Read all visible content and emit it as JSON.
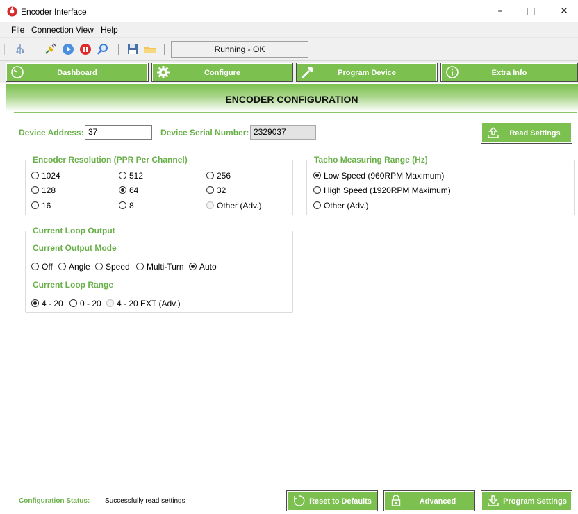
{
  "window": {
    "title": "Encoder Interface",
    "minimize": "–",
    "maximize": "□",
    "close": "✕"
  },
  "menu": [
    "File",
    "Connection",
    "View",
    "Help"
  ],
  "toolbar": {
    "status": "Running - OK",
    "icons": [
      "usb-icon",
      "plug-icon",
      "play-icon",
      "stop-icon",
      "search-icon",
      "save-icon",
      "folder-icon"
    ]
  },
  "nav": {
    "dashboard": "Dashboard",
    "configure": "Configure",
    "program_device": "Program Device",
    "extra_info": "Extra Info"
  },
  "page": {
    "title": "ENCODER CONFIGURATION"
  },
  "device": {
    "address_label": "Device Address:",
    "address_value": "37",
    "serial_label": "Device Serial Number:",
    "serial_value": "2329037",
    "read_settings": "Read Settings"
  },
  "resolution": {
    "title": "Encoder Resolution (PPR Per Channel)",
    "options": [
      {
        "label": "1024",
        "selected": false,
        "disabled": false
      },
      {
        "label": "512",
        "selected": false,
        "disabled": false
      },
      {
        "label": "256",
        "selected": false,
        "disabled": false
      },
      {
        "label": "128",
        "selected": false,
        "disabled": false
      },
      {
        "label": "64",
        "selected": true,
        "disabled": false
      },
      {
        "label": "32",
        "selected": false,
        "disabled": false
      },
      {
        "label": "16",
        "selected": false,
        "disabled": false
      },
      {
        "label": "8",
        "selected": false,
        "disabled": false
      },
      {
        "label": "Other (Adv.)",
        "selected": false,
        "disabled": true
      }
    ]
  },
  "tacho": {
    "title": "Tacho Measuring Range (Hz)",
    "options": [
      {
        "label": "Low Speed (960RPM Maximum)",
        "selected": true,
        "disabled": false
      },
      {
        "label": "High Speed (1920RPM Maximum)",
        "selected": false,
        "disabled": false
      },
      {
        "label": "Other (Adv.)",
        "selected": false,
        "disabled": false
      }
    ]
  },
  "current_loop": {
    "title": "Current Loop Output",
    "mode_label": "Current Output Mode",
    "modes": [
      {
        "label": "Off",
        "selected": false
      },
      {
        "label": "Angle",
        "selected": false
      },
      {
        "label": "Speed",
        "selected": false
      },
      {
        "label": "Multi-Turn",
        "selected": false
      },
      {
        "label": "Auto",
        "selected": true
      }
    ],
    "range_label": "Current Loop Range",
    "ranges": [
      {
        "label": "4 - 20",
        "selected": true,
        "disabled": false
      },
      {
        "label": "0 - 20",
        "selected": false,
        "disabled": false
      },
      {
        "label": "4 - 20 EXT (Adv.)",
        "selected": false,
        "disabled": true
      }
    ]
  },
  "footer": {
    "status_label": "Configuration Status:",
    "status_text": "Successfully read settings",
    "reset": "Reset to Defaults",
    "advanced": "Advanced",
    "program": "Program Settings"
  },
  "colors": {
    "accent": "#7cc04f",
    "label_green": "#6ab04a"
  }
}
